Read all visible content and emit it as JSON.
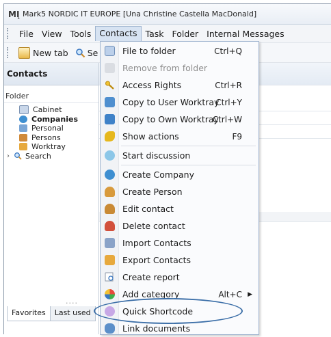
{
  "window": {
    "app_icon": "MĮ",
    "title": "Mark5 NORDIC IT EUROPE [Una Christine Castella MacDonald]"
  },
  "menubar": {
    "items": [
      "File",
      "View",
      "Tools",
      "Contacts",
      "Task",
      "Folder",
      "Internal Messages"
    ]
  },
  "toolbar": {
    "new_tab": "New tab",
    "search_partial": "Se"
  },
  "left_panel": {
    "title": "Contacts",
    "folder_label": "Folder",
    "tree": [
      {
        "label": "Cabinet",
        "icon": "cabinet-icon"
      },
      {
        "label": "Companies",
        "icon": "companies-icon",
        "bold": true
      },
      {
        "label": "Personal",
        "icon": "personal-icon"
      },
      {
        "label": "Persons",
        "icon": "persons-icon"
      },
      {
        "label": "Worktray",
        "icon": "worktray-icon"
      },
      {
        "label": "Search",
        "icon": "search-icon",
        "expandable": true
      }
    ],
    "tabs": [
      "Favorites",
      "Last used"
    ]
  },
  "contacts_menu": {
    "items": [
      {
        "label": "File to folder",
        "shortcut": "Ctrl+Q",
        "icon": "file-to-folder-icon"
      },
      {
        "label": "Remove from folder",
        "shortcut": "",
        "icon": "remove-from-folder-icon",
        "disabled": true
      },
      {
        "label": "Access Rights",
        "shortcut": "Ctrl+R",
        "icon": "key-icon"
      },
      {
        "label": "Copy to User Worktray",
        "shortcut": "Ctrl+Y",
        "icon": "copy-user-worktray-icon"
      },
      {
        "label": "Copy to Own Worktray",
        "shortcut": "Ctrl+W",
        "icon": "copy-own-worktray-icon"
      },
      {
        "label": "Show actions",
        "shortcut": "F9",
        "icon": "show-actions-icon"
      },
      {
        "label": "Start discussion",
        "shortcut": "",
        "icon": "discussion-icon"
      },
      {
        "label": "Create Company",
        "shortcut": "",
        "icon": "create-company-icon"
      },
      {
        "label": "Create Person",
        "shortcut": "",
        "icon": "create-person-icon"
      },
      {
        "label": "Edit contact",
        "shortcut": "",
        "icon": "edit-contact-icon"
      },
      {
        "label": "Delete contact",
        "shortcut": "",
        "icon": "delete-contact-icon"
      },
      {
        "label": "Import Contacts",
        "shortcut": "",
        "icon": "import-icon"
      },
      {
        "label": "Export Contacts",
        "shortcut": "",
        "icon": "export-icon"
      },
      {
        "label": "Create report",
        "shortcut": "",
        "icon": "report-icon"
      },
      {
        "label": "Add category",
        "shortcut": "Alt+C",
        "icon": "category-icon",
        "submenu": true
      },
      {
        "label": "Quick Shortcode",
        "shortcut": "",
        "icon": "shortcode-icon"
      },
      {
        "label": "Link documents",
        "shortcut": "",
        "icon": "link-icon"
      }
    ]
  },
  "colors": {
    "highlight": "#3c6fa8",
    "menu_open_bg": "#d7e3f2"
  }
}
